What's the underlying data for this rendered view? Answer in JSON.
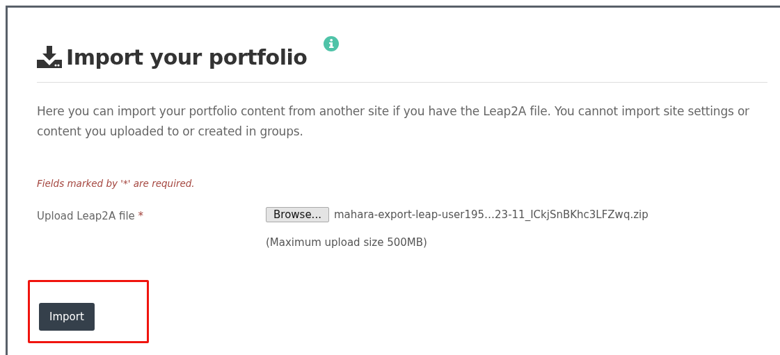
{
  "heading": {
    "title": "Import your portfolio"
  },
  "description": "Here you can import your portfolio content from another site if you have the Leap2A file. You cannot import site settings or content you uploaded to or created in groups.",
  "required_note": "Fields marked by '*' are required.",
  "fields": [
    {
      "label": "Upload Leap2A file",
      "required": true,
      "required_mark": "*",
      "button": "Browse...",
      "value": "mahara-export-leap-user195…23-11_ICkjSnBKhc3LFZwq.zip",
      "hint": "(Maximum upload size 500MB)"
    }
  ],
  "import_button": {
    "label": "Import",
    "highlighted": true
  }
}
